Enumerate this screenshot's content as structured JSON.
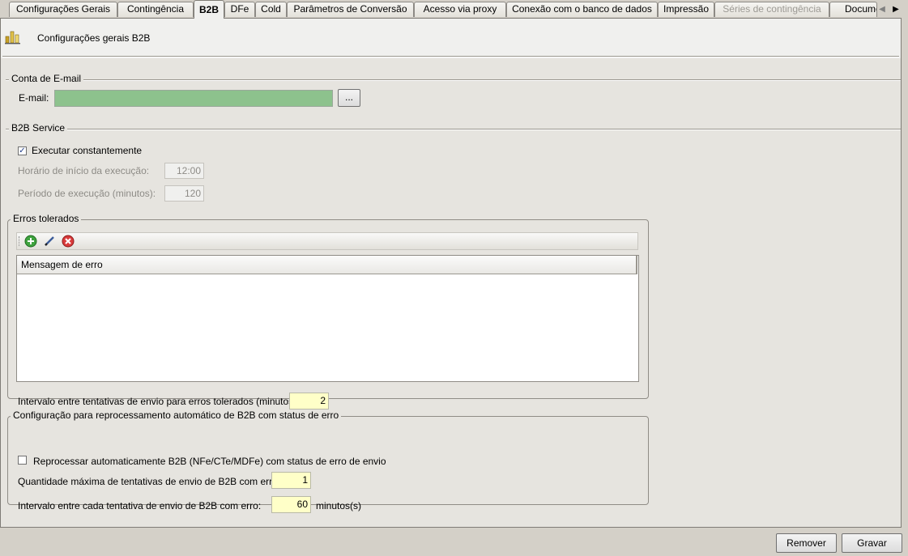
{
  "tabs": [
    {
      "label": "Configurações Gerais",
      "state": "normal"
    },
    {
      "label": "Contingência",
      "state": "normal"
    },
    {
      "label": "B2B",
      "state": "active"
    },
    {
      "label": "DFe",
      "state": "normal"
    },
    {
      "label": "Cold",
      "state": "normal"
    },
    {
      "label": "Parâmetros de Conversão",
      "state": "normal"
    },
    {
      "label": "Acesso via proxy",
      "state": "normal"
    },
    {
      "label": "Conexão com o banco de dados",
      "state": "normal"
    },
    {
      "label": "Impressão",
      "state": "normal"
    },
    {
      "label": "Séries de contingência",
      "state": "disabled"
    },
    {
      "label": "Docume",
      "state": "normal"
    }
  ],
  "tab_scroll": {
    "left_icon": "◀",
    "right_icon": "▶"
  },
  "header": {
    "title": "Configurações gerais B2B",
    "icon": "chart-bars-icon"
  },
  "email_section": {
    "title": "Conta de E-mail",
    "email_label": "E-mail:",
    "email_value": "",
    "browse_label": "..."
  },
  "service_section": {
    "title": "B2B Service",
    "run_constantly_label": "Executar constantemente",
    "run_constantly_checked": true,
    "start_time_label": "Horário de início da execução:",
    "start_time_value": "12:00",
    "period_label": "Período de execução (minutos):",
    "period_value": "120"
  },
  "errors_section": {
    "title": "Erros tolerados",
    "toolbar": {
      "add_icon": "add-icon",
      "edit_icon": "edit-icon",
      "delete_icon": "delete-icon"
    },
    "grid_header": "Mensagem de erro",
    "rows": [],
    "interval_label": "Intervalo entre tentativas de envio para erros tolerados (minutos):",
    "interval_value": "2"
  },
  "reprocess_section": {
    "title": "Configuração para reprocessamento automático de B2B com status de erro",
    "auto_label": "Reprocessar automaticamente B2B (NFe/CTe/MDFe) com status de erro de envio",
    "auto_checked": false,
    "max_attempts_label": "Quantidade máxima de tentativas de envio de B2B com erro:",
    "max_attempts_value": "1",
    "interval_label": "Intervalo entre cada tentativa de envio de B2B com erro:",
    "interval_value": "60",
    "interval_unit": "minutos(s)"
  },
  "footer": {
    "remove_label": "Remover",
    "save_label": "Gravar"
  },
  "colors": {
    "email_field": "#8dc28d",
    "yellow_field": "#ffffc8",
    "background": "#d4d0c8"
  }
}
